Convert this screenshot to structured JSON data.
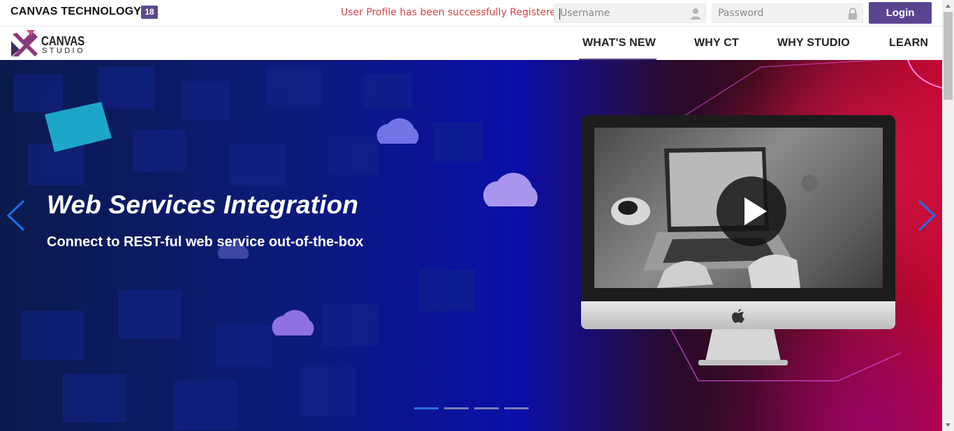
{
  "header": {
    "brand_name": "CANVAS TECHNOLOGY",
    "brand_badge": "18",
    "status_message": "User Profile has been successfully Registered",
    "username_placeholder": "Username",
    "password_placeholder": "Password",
    "login_label": "Login"
  },
  "nav": {
    "logo_word1": "CANVAS",
    "logo_word2": "STUDIO",
    "items": [
      {
        "label": "WHAT'S NEW",
        "active": true
      },
      {
        "label": "WHY CT",
        "active": false
      },
      {
        "label": "WHY STUDIO",
        "active": false
      },
      {
        "label": "LEARN",
        "active": false
      }
    ]
  },
  "hero": {
    "title": "Web Services Integration",
    "subtitle": "Connect to REST-ful web service out-of-the-box",
    "slide_count": 4,
    "active_slide": 1
  },
  "colors": {
    "accent": "#5a4591",
    "status_error": "#d64545",
    "indicator_active": "#2f6fe0",
    "arrow": "#1f6fe8"
  },
  "icons": {
    "username_field": "user-icon",
    "password_field": "lock-icon",
    "prev_slide": "chevron-left-icon",
    "next_slide": "chevron-right-icon",
    "video": "play-icon",
    "monitor_logo": "apple-logo-icon"
  }
}
